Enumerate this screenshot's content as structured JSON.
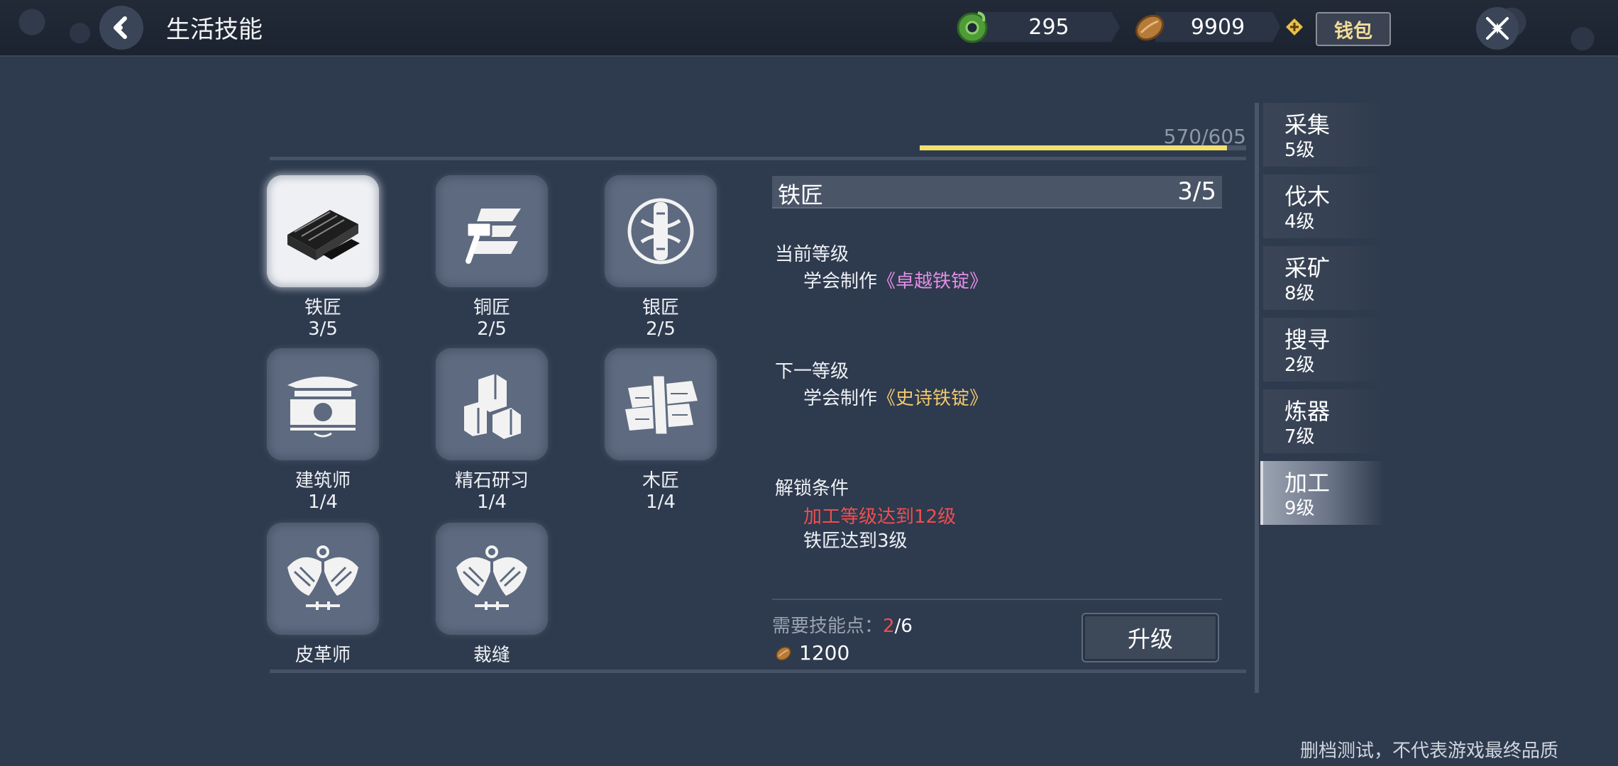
{
  "header": {
    "title": "生活技能",
    "back_icon": "chevron-left-icon",
    "jade_amount": "295",
    "coin_amount": "9909",
    "wallet_label": "钱包",
    "close_icon": "close-cross-icon"
  },
  "progress": {
    "text": "570/605",
    "value": 570,
    "max": 605,
    "color": "#f1e06e"
  },
  "skills": [
    {
      "name": "铁匠",
      "level": "3/5",
      "icon": "anvil-ingot-icon",
      "selected": true
    },
    {
      "name": "铜匠",
      "level": "2/5",
      "icon": "hammer-icon"
    },
    {
      "name": "银匠",
      "level": "2/5",
      "icon": "silver-coin-icon"
    },
    {
      "name": "建筑师",
      "level": "1/4",
      "icon": "building-icon"
    },
    {
      "name": "精石研习",
      "level": "1/4",
      "icon": "stone-blocks-icon"
    },
    {
      "name": "木匠",
      "level": "1/4",
      "icon": "wood-plank-icon"
    },
    {
      "name": "皮革师",
      "level": "",
      "icon": "wings-emblem-icon"
    },
    {
      "name": "裁缝",
      "level": "",
      "icon": "wings-emblem-icon"
    }
  ],
  "detail": {
    "title": "铁匠",
    "level": "3/5",
    "current_label": "当前等级",
    "current_prefix": "学会制作",
    "current_item": "《卓越铁锭》",
    "next_label": "下一等级",
    "next_prefix": "学会制作",
    "next_item": "《史诗铁锭》",
    "unlock_label": "解锁条件",
    "unlock_cond_1": "加工等级达到12级",
    "unlock_cond_2": "铁匠达到3级",
    "skill_points_label": "需要技能点：",
    "skill_points_have": "2",
    "skill_points_need": "/6",
    "coin_cost": "1200",
    "upgrade_label": "升级"
  },
  "tabs": [
    {
      "name": "采集",
      "level": "5级"
    },
    {
      "name": "伐木",
      "level": "4级"
    },
    {
      "name": "采矿",
      "level": "8级"
    },
    {
      "name": "搜寻",
      "level": "2级"
    },
    {
      "name": "炼器",
      "level": "7级"
    },
    {
      "name": "加工",
      "level": "9级",
      "active": true
    }
  ],
  "footer_note": "删档测试，不代表游戏最终品质",
  "colors": {
    "background": "#2e3a4e",
    "red_text": "#ee4f4f",
    "purple_item": "#e28ee4",
    "gold_item": "#f0c86c"
  }
}
